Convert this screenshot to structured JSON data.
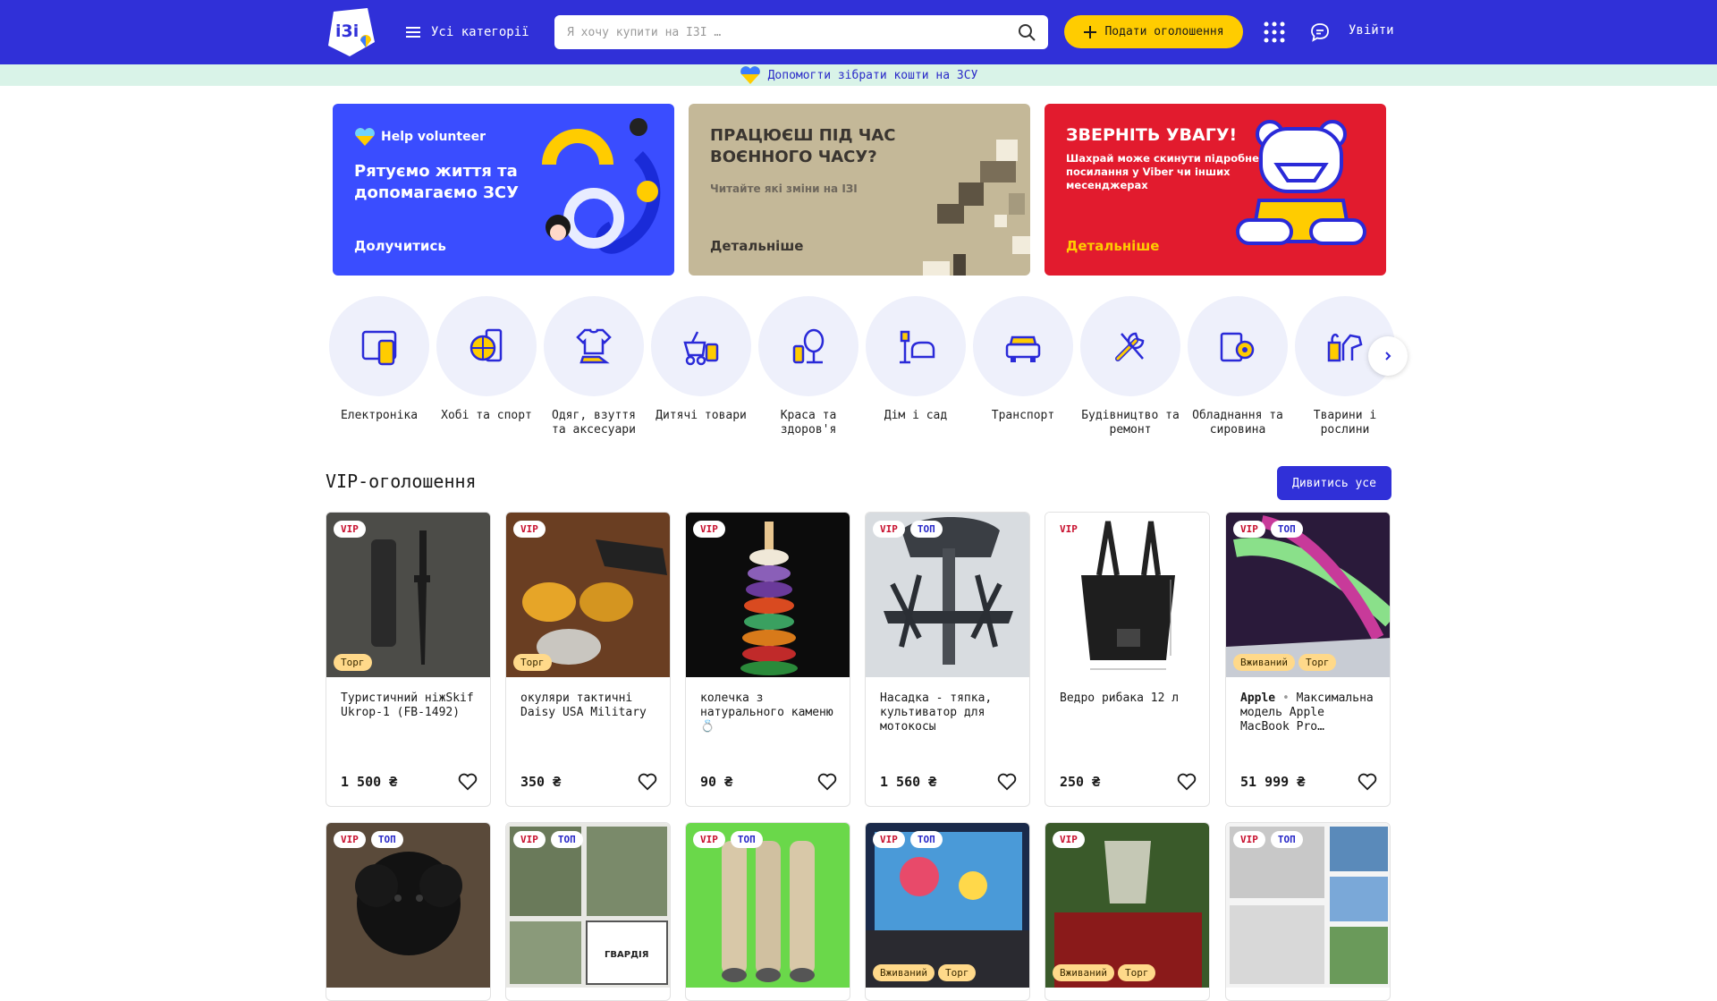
{
  "header": {
    "logo": "i3i",
    "categories_label": "Усі категорії",
    "search_placeholder": "Я хочу купити на ІЗІ …",
    "post_ad_label": "Подати оголошення",
    "login_label": "Увійти"
  },
  "donate_banner": {
    "text": "Допомогти зібрати кошти на ЗСУ"
  },
  "promos": [
    {
      "badge": "Help volunteer",
      "title": "Рятуємо життя та допомагаємо ЗСУ",
      "cta": "Долучитись",
      "bg": "#3a4dff"
    },
    {
      "title": "ПРАЦЮЄШ ПІД ЧАС ВОЄННОГО ЧАСУ?",
      "subtitle": "Читайте які зміни на ІЗІ",
      "cta": "Детальніше",
      "bg": "#c4b898"
    },
    {
      "title": "ЗВЕРНІТЬ УВАГУ!",
      "subtitle": "Шахрай може скинути підробне посилання у Viber чи інших месенджерах",
      "cta": "Детальніше",
      "bg": "#e21b2e"
    }
  ],
  "categories": [
    {
      "label": "Електроніка",
      "icon": "tablet-icon"
    },
    {
      "label": "Хобі та спорт",
      "icon": "ball-icon"
    },
    {
      "label": "Одяг, взуття та аксесуари",
      "icon": "tshirt-icon"
    },
    {
      "label": "Дитячі товари",
      "icon": "stroller-icon"
    },
    {
      "label": "Краса та здоров'я",
      "icon": "mirror-icon"
    },
    {
      "label": "Дім і сад",
      "icon": "armchair-icon"
    },
    {
      "label": "Транспорт",
      "icon": "car-icon"
    },
    {
      "label": "Будівництво та ремонт",
      "icon": "tools-icon"
    },
    {
      "label": "Обладнання та сировина",
      "icon": "gear-icon"
    },
    {
      "label": "Тварини і рослини",
      "icon": "dog-icon"
    }
  ],
  "vip": {
    "title": "VIP-оголошення",
    "see_all": "Дивитись усе",
    "row1": [
      {
        "tags": [
          "VIP"
        ],
        "bottom_tags": [
          "Торг"
        ],
        "name": "Туристичний ніжSkif Ukrop-1 (FB-1492)",
        "price": "1 500 ₴",
        "img": "knife"
      },
      {
        "tags": [
          "VIP"
        ],
        "bottom_tags": [
          "Торг"
        ],
        "name": "окуляри тактичні Daisy USA Military",
        "price": "350 ₴",
        "img": "glasses"
      },
      {
        "tags": [
          "VIP"
        ],
        "bottom_tags": [],
        "name": "колечка з натурального каменю💍",
        "price": "90 ₴",
        "img": "rings"
      },
      {
        "tags": [
          "VIP",
          "ТОП"
        ],
        "bottom_tags": [],
        "name": "Насадка - тяпка, культиватор для мотокосы",
        "price": "1 560 ₴",
        "img": "tiller"
      },
      {
        "tags": [
          "VIP"
        ],
        "bottom_tags": [],
        "name": "Ведро рибака 12 л",
        "price": "250 ₴",
        "img": "bucket"
      },
      {
        "tags": [
          "VIP",
          "ТОП"
        ],
        "bottom_tags": [
          "Вживаний",
          "Торг"
        ],
        "brand": "Apple",
        "name": "Максимальна модель Apple MacBook Pro…",
        "price": "51 999 ₴",
        "img": "macbook"
      }
    ],
    "row2": [
      {
        "tags": [
          "VIP",
          "ТОП"
        ],
        "img": "puppy"
      },
      {
        "tags": [
          "VIP",
          "ТОП"
        ],
        "img": "stamps"
      },
      {
        "tags": [
          "VIP",
          "ТОП"
        ],
        "img": "rolls"
      },
      {
        "tags": [
          "VIP",
          "ТОП"
        ],
        "bottom_tags": [
          "Вживаний",
          "Торг"
        ],
        "img": "laptop"
      },
      {
        "tags": [
          "VIP"
        ],
        "bottom_tags": [
          "Вживаний",
          "Торг"
        ],
        "img": "glass"
      },
      {
        "tags": [
          "VIP",
          "ТОП"
        ],
        "img": "newspaper"
      }
    ]
  },
  "colors": {
    "primary": "#3030d8",
    "accent": "#ffcc00",
    "vip_red": "#c8102e"
  }
}
